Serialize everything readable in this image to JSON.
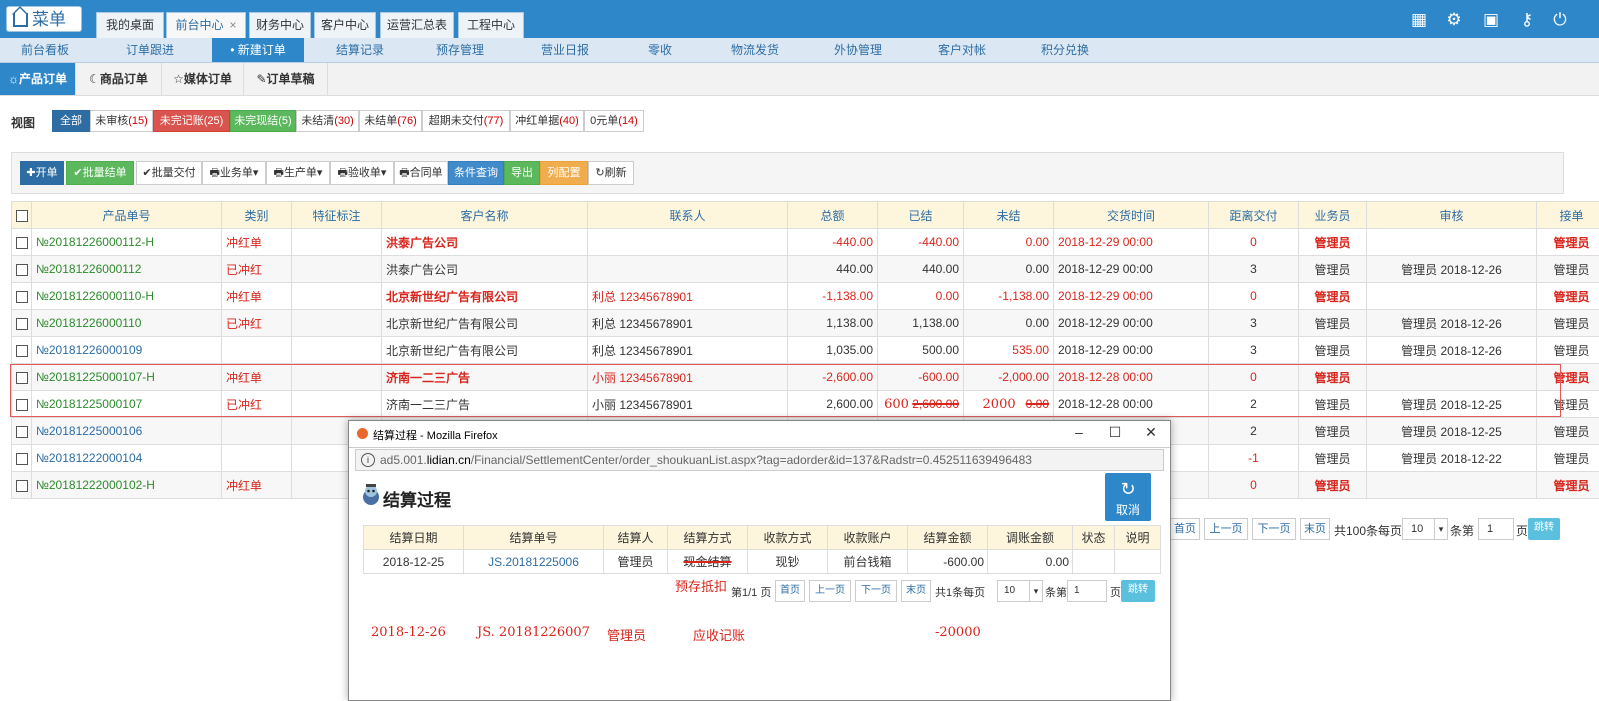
{
  "topbar": {
    "menu_label": "菜单",
    "tabs": [
      {
        "label": "我的桌面"
      },
      {
        "label": "前台中心",
        "close": "×"
      },
      {
        "label": "财务中心"
      },
      {
        "label": "客户中心"
      },
      {
        "label": "运营汇总表"
      },
      {
        "label": "工程中心"
      }
    ],
    "icons": [
      "grid-icon",
      "gear-icon",
      "shirt-icon",
      "key-icon",
      "power-icon"
    ]
  },
  "nav2": [
    "前台看板",
    "订单跟进",
    "• 新建订单",
    "结算记录",
    "预存管理",
    "营业日报",
    "零收",
    "物流发货",
    "外协管理",
    "客户对帐",
    "积分兑换"
  ],
  "nav3": [
    {
      "icon": "☼",
      "label": "产品订单"
    },
    {
      "icon": "☾",
      "label": "商品订单"
    },
    {
      "icon": "☆",
      "label": "媒体订单"
    },
    {
      "icon": "✎",
      "label": "订单草稿"
    }
  ],
  "view": {
    "label": "视图",
    "filters": [
      {
        "label": "全部",
        "count": ""
      },
      {
        "label": "未审核",
        "count": "(15)"
      },
      {
        "label": "未完记账",
        "count": "(25)"
      },
      {
        "label": "未完现结",
        "count": "(5)"
      },
      {
        "label": "未结清",
        "count": "(30)"
      },
      {
        "label": "未结单",
        "count": "(76)"
      },
      {
        "label": "超期未交付",
        "count": "(77)"
      },
      {
        "label": "冲红单据",
        "count": "(40)"
      },
      {
        "label": "0元单",
        "count": "(14)"
      }
    ]
  },
  "toolbar": [
    "✚开单",
    "✔批量结单",
    "✔批量交付",
    "🖶业务单▾",
    "🖶生产单▾",
    "🖶验收单▾",
    "🖶合同单",
    "条件查询",
    "导出",
    "列配置",
    "↻刷新"
  ],
  "table": {
    "headers": [
      "",
      "产品单号",
      "类别",
      "特征标注",
      "客户名称",
      "联系人",
      "总额",
      "已结",
      "未结",
      "交货时间",
      "距离交付",
      "业务员",
      "审核",
      "接单"
    ],
    "rows": [
      {
        "order": "№20181226000112-H",
        "type": "冲红单",
        "mark": "",
        "customer": "洪泰广告公司",
        "contact": "",
        "total": "-440.00",
        "paid": "-440.00",
        "unpaid": "0.00",
        "delivery": "2018-12-29 00:00",
        "days": "0",
        "sales": "管理员",
        "audit": "",
        "receiver": "管理员"
      },
      {
        "order": "№20181226000112",
        "type": "已冲红",
        "mark": "",
        "customer": "洪泰广告公司",
        "contact": "",
        "total": "440.00",
        "paid": "440.00",
        "unpaid": "0.00",
        "delivery": "2018-12-29 00:00",
        "days": "3",
        "sales": "管理员",
        "audit": "管理员 2018-12-26",
        "receiver": "管理员"
      },
      {
        "order": "№20181226000110-H",
        "type": "冲红单",
        "mark": "",
        "customer": "北京新世纪广告有限公司",
        "contact": "利总 12345678901",
        "total": "-1,138.00",
        "paid": "0.00",
        "unpaid": "-1,138.00",
        "delivery": "2018-12-29 00:00",
        "days": "0",
        "sales": "管理员",
        "audit": "",
        "receiver": "管理员"
      },
      {
        "order": "№20181226000110",
        "type": "已冲红",
        "mark": "",
        "customer": "北京新世纪广告有限公司",
        "contact": "利总 12345678901",
        "total": "1,138.00",
        "paid": "1,138.00",
        "unpaid": "0.00",
        "delivery": "2018-12-29 00:00",
        "days": "3",
        "sales": "管理员",
        "audit": "管理员 2018-12-26",
        "receiver": "管理员"
      },
      {
        "order": "№20181226000109",
        "type": "",
        "mark": "",
        "customer": "北京新世纪广告有限公司",
        "contact": "利总 12345678901",
        "total": "1,035.00",
        "paid": "500.00",
        "unpaid": "535.00",
        "delivery": "2018-12-29 00:00",
        "days": "3",
        "sales": "管理员",
        "audit": "管理员 2018-12-26",
        "receiver": "管理员"
      },
      {
        "order": "№20181225000107-H",
        "type": "冲红单",
        "mark": "",
        "customer": "济南一二三广告",
        "contact": "小丽 12345678901",
        "total": "-2,600.00",
        "paid": "-600.00",
        "unpaid": "-2,000.00",
        "delivery": "2018-12-28 00:00",
        "days": "0",
        "sales": "管理员",
        "audit": "",
        "receiver": "管理员"
      },
      {
        "order": "№20181225000107",
        "type": "已冲红",
        "mark": "",
        "customer": "济南一二三广告",
        "contact": "小丽 12345678901",
        "total": "2,600.00",
        "paid_hand": "600",
        "paid": "2,600.00",
        "unpaid_hand": "2000",
        "unpaid": "0.00",
        "delivery": "2018-12-28 00:00",
        "days": "2",
        "sales": "管理员",
        "audit": "管理员 2018-12-25",
        "receiver": "管理员"
      },
      {
        "order": "№20181225000106",
        "days": "2",
        "sales": "管理员",
        "audit": "管理员 2018-12-25",
        "receiver": "管理员"
      },
      {
        "order": "№20181222000104",
        "days": "-1",
        "sales": "管理员",
        "audit": "管理员 2018-12-22",
        "receiver": "管理员"
      },
      {
        "order": "№20181222000102-H",
        "type": "冲红单",
        "days": "0",
        "sales": "管理员",
        "audit": "",
        "receiver": "管理员"
      }
    ]
  },
  "pager": {
    "first": "首页",
    "prev": "上一页",
    "next": "下一页",
    "last": "末页",
    "text1": "共100条每页",
    "size": "10",
    "text2": "条第",
    "page": "1",
    "text3": "页",
    "jump": "跳转"
  },
  "popup": {
    "title": "结算过程 - Mozilla Firefox",
    "url_prefix": "ad5.001.",
    "url_host": "lidian.cn",
    "url_rest": "/Financial/SettlementCenter/order_shoukuanList.aspx?tag=adorder&id=137&Radstr=0.452511639496483",
    "heading": "结算过程",
    "cancel": "取消",
    "headers": [
      "结算日期",
      "结算单号",
      "结算人",
      "结算方式",
      "收款方式",
      "收款账户",
      "结算金额",
      "调账金额",
      "状态",
      "说明"
    ],
    "row": {
      "date": "2018-12-25",
      "no": "JS.20181225006",
      "person": "管理员",
      "method": "现金结算",
      "pay": "现钞",
      "account": "前台钱箱",
      "amount": "-600.00",
      "adjust": "0.00",
      "status": "",
      "note": ""
    },
    "hand_method": "预存抵扣",
    "pager": {
      "text0": "第1/1 页",
      "first": "首页",
      "prev": "上一页",
      "next": "下一页",
      "last": "末页",
      "text1": "共1条每页",
      "size": "10",
      "text2": "条第",
      "page": "1",
      "text3": "页",
      "jump": "跳转"
    },
    "hand_row": {
      "date": "2018-12-26",
      "no": "JS. 20181226007",
      "person": "管理员",
      "method": "应收记账",
      "amount": "-20000"
    }
  }
}
